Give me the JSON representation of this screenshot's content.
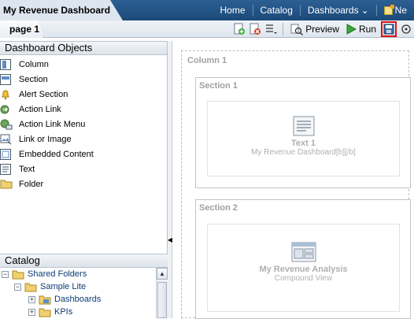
{
  "header": {
    "title": "My Revenue Dashboard",
    "nav": {
      "home": "Home",
      "catalog": "Catalog",
      "dashboards": "Dashboards",
      "new": "Ne"
    }
  },
  "tabbar": {
    "page_tab": "page 1",
    "toolbar": {
      "preview": "Preview",
      "run": "Run"
    }
  },
  "dashboard_objects": {
    "title": "Dashboard Objects",
    "items": [
      {
        "label": "Column",
        "icon": "column-icon"
      },
      {
        "label": "Section",
        "icon": "section-icon"
      },
      {
        "label": "Alert Section",
        "icon": "bell-icon"
      },
      {
        "label": "Action Link",
        "icon": "action-link-icon"
      },
      {
        "label": "Action Link Menu",
        "icon": "action-link-menu-icon"
      },
      {
        "label": "Link or Image",
        "icon": "link-image-icon"
      },
      {
        "label": "Embedded Content",
        "icon": "embedded-content-icon"
      },
      {
        "label": "Text",
        "icon": "text-icon"
      },
      {
        "label": "Folder",
        "icon": "folder-icon"
      }
    ]
  },
  "catalog": {
    "title": "Catalog",
    "tree": [
      {
        "label": "Shared Folders"
      },
      {
        "label": "Sample Lite"
      },
      {
        "label": "Dashboards"
      },
      {
        "label": "KPIs"
      }
    ]
  },
  "canvas": {
    "column_title": "Column 1",
    "sections": [
      {
        "title": "Section 1",
        "object": {
          "name": "Text 1",
          "subtitle": "My Revenue Dashboard[b][/b]"
        }
      },
      {
        "title": "Section 2",
        "object": {
          "name": "My Revenue Analysis",
          "subtitle": "Compound View"
        }
      }
    ]
  },
  "colors": {
    "header_blue": "#1c4a7a",
    "highlight_red": "#e01010",
    "link_blue": "#0c3b73"
  }
}
